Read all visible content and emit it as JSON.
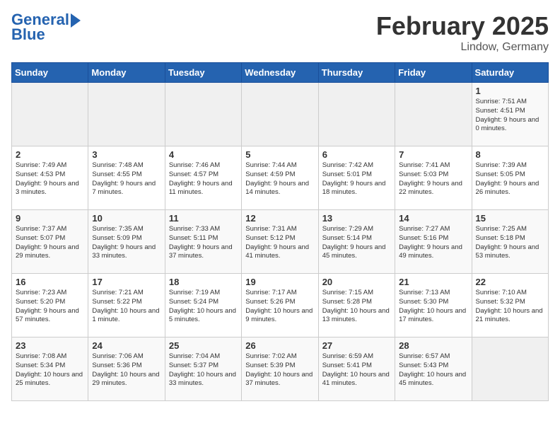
{
  "header": {
    "logo_line1": "General",
    "logo_line2": "Blue",
    "title": "February 2025",
    "subtitle": "Lindow, Germany"
  },
  "days_of_week": [
    "Sunday",
    "Monday",
    "Tuesday",
    "Wednesday",
    "Thursday",
    "Friday",
    "Saturday"
  ],
  "weeks": [
    [
      {
        "day": "",
        "info": ""
      },
      {
        "day": "",
        "info": ""
      },
      {
        "day": "",
        "info": ""
      },
      {
        "day": "",
        "info": ""
      },
      {
        "day": "",
        "info": ""
      },
      {
        "day": "",
        "info": ""
      },
      {
        "day": "1",
        "info": "Sunrise: 7:51 AM\nSunset: 4:51 PM\nDaylight: 9 hours and 0 minutes."
      }
    ],
    [
      {
        "day": "2",
        "info": "Sunrise: 7:49 AM\nSunset: 4:53 PM\nDaylight: 9 hours and 3 minutes."
      },
      {
        "day": "3",
        "info": "Sunrise: 7:48 AM\nSunset: 4:55 PM\nDaylight: 9 hours and 7 minutes."
      },
      {
        "day": "4",
        "info": "Sunrise: 7:46 AM\nSunset: 4:57 PM\nDaylight: 9 hours and 11 minutes."
      },
      {
        "day": "5",
        "info": "Sunrise: 7:44 AM\nSunset: 4:59 PM\nDaylight: 9 hours and 14 minutes."
      },
      {
        "day": "6",
        "info": "Sunrise: 7:42 AM\nSunset: 5:01 PM\nDaylight: 9 hours and 18 minutes."
      },
      {
        "day": "7",
        "info": "Sunrise: 7:41 AM\nSunset: 5:03 PM\nDaylight: 9 hours and 22 minutes."
      },
      {
        "day": "8",
        "info": "Sunrise: 7:39 AM\nSunset: 5:05 PM\nDaylight: 9 hours and 26 minutes."
      }
    ],
    [
      {
        "day": "9",
        "info": "Sunrise: 7:37 AM\nSunset: 5:07 PM\nDaylight: 9 hours and 29 minutes."
      },
      {
        "day": "10",
        "info": "Sunrise: 7:35 AM\nSunset: 5:09 PM\nDaylight: 9 hours and 33 minutes."
      },
      {
        "day": "11",
        "info": "Sunrise: 7:33 AM\nSunset: 5:11 PM\nDaylight: 9 hours and 37 minutes."
      },
      {
        "day": "12",
        "info": "Sunrise: 7:31 AM\nSunset: 5:12 PM\nDaylight: 9 hours and 41 minutes."
      },
      {
        "day": "13",
        "info": "Sunrise: 7:29 AM\nSunset: 5:14 PM\nDaylight: 9 hours and 45 minutes."
      },
      {
        "day": "14",
        "info": "Sunrise: 7:27 AM\nSunset: 5:16 PM\nDaylight: 9 hours and 49 minutes."
      },
      {
        "day": "15",
        "info": "Sunrise: 7:25 AM\nSunset: 5:18 PM\nDaylight: 9 hours and 53 minutes."
      }
    ],
    [
      {
        "day": "16",
        "info": "Sunrise: 7:23 AM\nSunset: 5:20 PM\nDaylight: 9 hours and 57 minutes."
      },
      {
        "day": "17",
        "info": "Sunrise: 7:21 AM\nSunset: 5:22 PM\nDaylight: 10 hours and 1 minute."
      },
      {
        "day": "18",
        "info": "Sunrise: 7:19 AM\nSunset: 5:24 PM\nDaylight: 10 hours and 5 minutes."
      },
      {
        "day": "19",
        "info": "Sunrise: 7:17 AM\nSunset: 5:26 PM\nDaylight: 10 hours and 9 minutes."
      },
      {
        "day": "20",
        "info": "Sunrise: 7:15 AM\nSunset: 5:28 PM\nDaylight: 10 hours and 13 minutes."
      },
      {
        "day": "21",
        "info": "Sunrise: 7:13 AM\nSunset: 5:30 PM\nDaylight: 10 hours and 17 minutes."
      },
      {
        "day": "22",
        "info": "Sunrise: 7:10 AM\nSunset: 5:32 PM\nDaylight: 10 hours and 21 minutes."
      }
    ],
    [
      {
        "day": "23",
        "info": "Sunrise: 7:08 AM\nSunset: 5:34 PM\nDaylight: 10 hours and 25 minutes."
      },
      {
        "day": "24",
        "info": "Sunrise: 7:06 AM\nSunset: 5:36 PM\nDaylight: 10 hours and 29 minutes."
      },
      {
        "day": "25",
        "info": "Sunrise: 7:04 AM\nSunset: 5:37 PM\nDaylight: 10 hours and 33 minutes."
      },
      {
        "day": "26",
        "info": "Sunrise: 7:02 AM\nSunset: 5:39 PM\nDaylight: 10 hours and 37 minutes."
      },
      {
        "day": "27",
        "info": "Sunrise: 6:59 AM\nSunset: 5:41 PM\nDaylight: 10 hours and 41 minutes."
      },
      {
        "day": "28",
        "info": "Sunrise: 6:57 AM\nSunset: 5:43 PM\nDaylight: 10 hours and 45 minutes."
      },
      {
        "day": "",
        "info": ""
      }
    ]
  ]
}
